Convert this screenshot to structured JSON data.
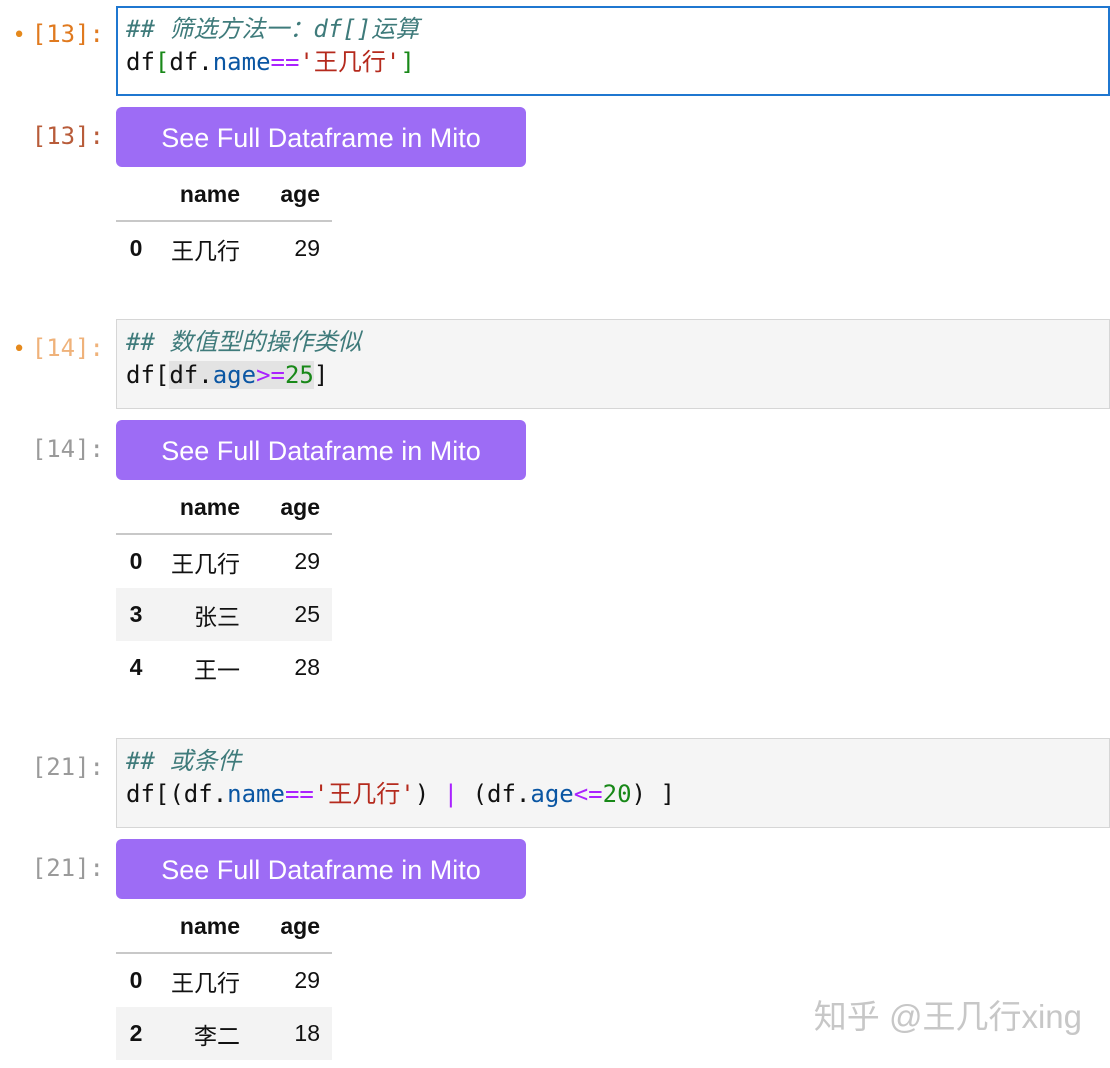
{
  "cells": [
    {
      "in_prompt": "[13]:",
      "code_comment": "## 筛选方法一：df[]运算",
      "out_prompt": "[13]:",
      "mito_label": "See Full Dataframe in Mito",
      "table": {
        "columns": [
          "name",
          "age"
        ],
        "rows": [
          {
            "index": "0",
            "name": "王几行",
            "age": "29"
          }
        ]
      }
    },
    {
      "in_prompt": "[14]:",
      "code_comment": "## 数值型的操作类似",
      "out_prompt": "[14]:",
      "mito_label": "See Full Dataframe in Mito",
      "table": {
        "columns": [
          "name",
          "age"
        ],
        "rows": [
          {
            "index": "0",
            "name": "王几行",
            "age": "29"
          },
          {
            "index": "3",
            "name": "张三",
            "age": "25"
          },
          {
            "index": "4",
            "name": "王一",
            "age": "28"
          }
        ]
      }
    },
    {
      "in_prompt": "[21]:",
      "code_comment": "## 或条件",
      "out_prompt": "[21]:",
      "mito_label": "See Full Dataframe in Mito",
      "table": {
        "columns": [
          "name",
          "age"
        ],
        "rows": [
          {
            "index": "0",
            "name": "王几行",
            "age": "29"
          },
          {
            "index": "2",
            "name": "李二",
            "age": "18"
          }
        ]
      }
    }
  ],
  "code": {
    "c1": {
      "t1": "df",
      "t2": "[",
      "t3": "df.",
      "t4": "name",
      "t5": "==",
      "t6": "'王几行'",
      "t7": "]"
    },
    "c2": {
      "t1": "df[",
      "t2": "df.",
      "t3": "age",
      "t4": ">=",
      "t5": "25",
      "t6": "]"
    },
    "c3": {
      "t1": "df[(df.",
      "t2": "name",
      "t3": "==",
      "t4": "'王几行'",
      "t5": ") ",
      "t6": "|",
      "t7": " (df.",
      "t8": "age",
      "t9": "<=",
      "t10": "20",
      "t11": ") ]"
    }
  },
  "watermark": "知乎 @王几行xing",
  "colors": {
    "mito_button": "#9d6cf5",
    "active_border": "#1f77d0",
    "prompt_active": "#e07a1f"
  }
}
